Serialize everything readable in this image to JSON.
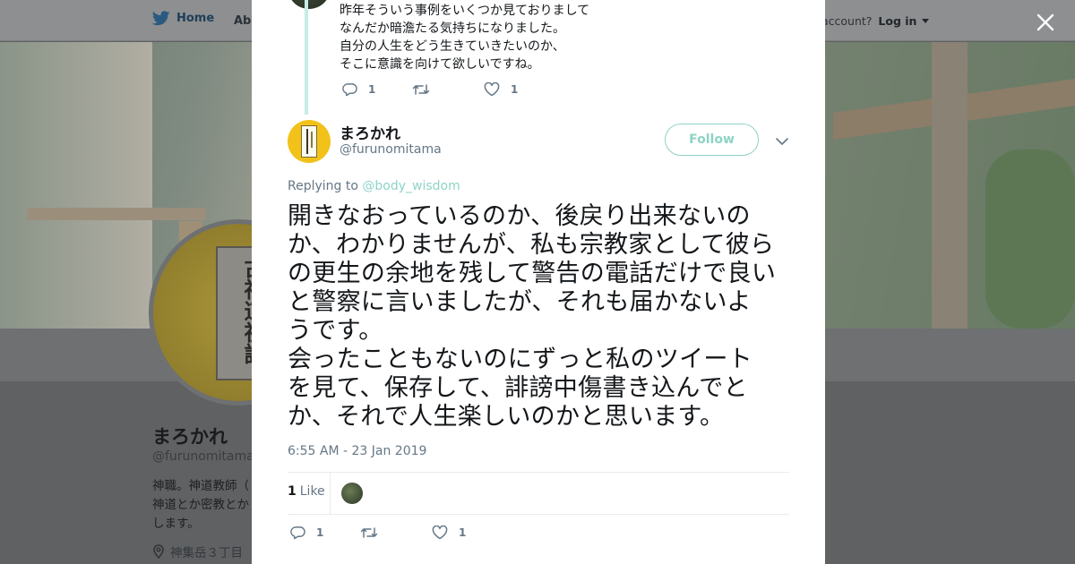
{
  "nav": {
    "home_label": "Home",
    "about_label": "Abo",
    "account_prompt": "account?",
    "login_label": "Log in"
  },
  "profile": {
    "name": "まろかれ",
    "handle": "@furunomitama",
    "bio_lines": [
      "神職。神道教師（",
      "神道とか密教とか",
      "します。"
    ],
    "location": "神集岳３丁目"
  },
  "avatar_label": "古神道祝詞",
  "prev_tweet": {
    "lines": [
      "昨年そういう事例をいくつか見ておりまして",
      "なんだか暗澹たる気持ちになりました。",
      "自分の人生をどう生きていきたいのか、",
      "そこに意識を向けて欲しいですね。"
    ],
    "reply_count": "1",
    "retweet_count": "",
    "like_count": "1"
  },
  "tweet": {
    "author_name": "まろかれ",
    "author_handle": "@furunomitama",
    "follow_label": "Follow",
    "replying_prefix": "Replying to",
    "replying_to": "@body_wisdom",
    "body_lines": [
      "開きなおっているのか、後戻り出来ないの",
      "か、わかりませんが、私も宗教家として彼ら",
      "の更生の余地を残して警告の電話だけで良い",
      "と警察に言いましたが、それも届かないよ",
      "うです。",
      "会ったこともないのにずっと私のツイート",
      "を見て、保存して、誹謗中傷書き込んでと",
      "か、それで人生楽しいのかと思います。"
    ],
    "timestamp": "6:55 AM - 23 Jan 2019",
    "likes_number": "1",
    "likes_label": "Like",
    "reply_count": "1",
    "retweet_count": "",
    "like_count": "1"
  },
  "colors": {
    "accent": "#8ed3c6",
    "thread_line": "#c7ece6",
    "text_primary": "#14171a",
    "text_secondary": "#657786"
  },
  "icons": [
    "twitter-bird-icon",
    "close-icon",
    "chevron-down-icon",
    "reply-icon",
    "retweet-icon",
    "heart-icon",
    "location-pin-icon"
  ]
}
